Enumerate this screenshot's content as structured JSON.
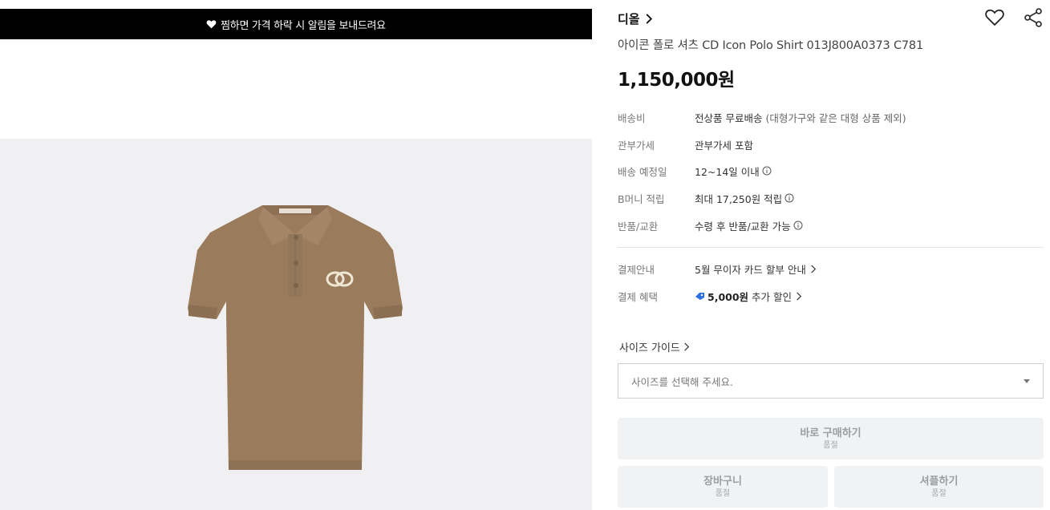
{
  "banner": {
    "text": "찜하면 가격 하락 시 알림을 보내드려요"
  },
  "product": {
    "brand": "디올",
    "title": "아이콘 폴로 셔츠 CD Icon Polo Shirt 013J800A0373 C781",
    "price": "1,150,000원",
    "image_bg": "#f0f0f2",
    "shirt_color": "#9a7b5c"
  },
  "info": [
    {
      "label": "배송비",
      "value": "전상품 무료배송",
      "extra": "(대형가구와 같은 대형 상품 제외)"
    },
    {
      "label": "관부가세",
      "value": "관부가세 포함"
    },
    {
      "label": "배송 예정일",
      "value": "12~14일 이내"
    },
    {
      "label": "B머니 적립",
      "value": "최대 17,250원 적립"
    },
    {
      "label": "반품/교환",
      "value": "수령 후 반품/교환 가능"
    }
  ],
  "payment": {
    "label": "결제안내",
    "value": "5월 무이자 카드 할부 안내"
  },
  "benefit": {
    "label": "결제 혜택",
    "amount": "5,000원",
    "value": "추가 할인"
  },
  "size": {
    "guide_label": "사이즈 가이드",
    "placeholder": "사이즈를 선택해 주세요."
  },
  "buttons": {
    "buy": {
      "label": "바로 구매하기",
      "sub": "품절"
    },
    "cart": {
      "label": "장바구니",
      "sub": "품절"
    },
    "share_buy": {
      "label": "셔플하기",
      "sub": "품절"
    }
  },
  "icons": {
    "heart": "heart-icon",
    "share": "share-icon",
    "info": "info-icon",
    "coupon": "coupon-icon"
  }
}
